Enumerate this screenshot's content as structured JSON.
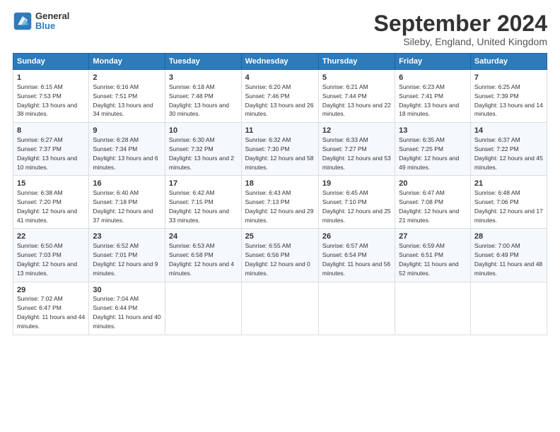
{
  "header": {
    "logo_line1": "General",
    "logo_line2": "Blue",
    "title": "September 2024",
    "subtitle": "Sileby, England, United Kingdom"
  },
  "weekdays": [
    "Sunday",
    "Monday",
    "Tuesday",
    "Wednesday",
    "Thursday",
    "Friday",
    "Saturday"
  ],
  "weeks": [
    [
      {
        "day": 1,
        "rise": "6:15 AM",
        "set": "7:53 PM",
        "daylight": "13 hours and 38 minutes."
      },
      {
        "day": 2,
        "rise": "6:16 AM",
        "set": "7:51 PM",
        "daylight": "13 hours and 34 minutes."
      },
      {
        "day": 3,
        "rise": "6:18 AM",
        "set": "7:48 PM",
        "daylight": "13 hours and 30 minutes."
      },
      {
        "day": 4,
        "rise": "6:20 AM",
        "set": "7:46 PM",
        "daylight": "13 hours and 26 minutes."
      },
      {
        "day": 5,
        "rise": "6:21 AM",
        "set": "7:44 PM",
        "daylight": "13 hours and 22 minutes."
      },
      {
        "day": 6,
        "rise": "6:23 AM",
        "set": "7:41 PM",
        "daylight": "13 hours and 18 minutes."
      },
      {
        "day": 7,
        "rise": "6:25 AM",
        "set": "7:39 PM",
        "daylight": "13 hours and 14 minutes."
      }
    ],
    [
      {
        "day": 8,
        "rise": "6:27 AM",
        "set": "7:37 PM",
        "daylight": "13 hours and 10 minutes."
      },
      {
        "day": 9,
        "rise": "6:28 AM",
        "set": "7:34 PM",
        "daylight": "13 hours and 6 minutes."
      },
      {
        "day": 10,
        "rise": "6:30 AM",
        "set": "7:32 PM",
        "daylight": "13 hours and 2 minutes."
      },
      {
        "day": 11,
        "rise": "6:32 AM",
        "set": "7:30 PM",
        "daylight": "12 hours and 58 minutes."
      },
      {
        "day": 12,
        "rise": "6:33 AM",
        "set": "7:27 PM",
        "daylight": "12 hours and 53 minutes."
      },
      {
        "day": 13,
        "rise": "6:35 AM",
        "set": "7:25 PM",
        "daylight": "12 hours and 49 minutes."
      },
      {
        "day": 14,
        "rise": "6:37 AM",
        "set": "7:22 PM",
        "daylight": "12 hours and 45 minutes."
      }
    ],
    [
      {
        "day": 15,
        "rise": "6:38 AM",
        "set": "7:20 PM",
        "daylight": "12 hours and 41 minutes."
      },
      {
        "day": 16,
        "rise": "6:40 AM",
        "set": "7:18 PM",
        "daylight": "12 hours and 37 minutes."
      },
      {
        "day": 17,
        "rise": "6:42 AM",
        "set": "7:15 PM",
        "daylight": "12 hours and 33 minutes."
      },
      {
        "day": 18,
        "rise": "6:43 AM",
        "set": "7:13 PM",
        "daylight": "12 hours and 29 minutes."
      },
      {
        "day": 19,
        "rise": "6:45 AM",
        "set": "7:10 PM",
        "daylight": "12 hours and 25 minutes."
      },
      {
        "day": 20,
        "rise": "6:47 AM",
        "set": "7:08 PM",
        "daylight": "12 hours and 21 minutes."
      },
      {
        "day": 21,
        "rise": "6:48 AM",
        "set": "7:06 PM",
        "daylight": "12 hours and 17 minutes."
      }
    ],
    [
      {
        "day": 22,
        "rise": "6:50 AM",
        "set": "7:03 PM",
        "daylight": "12 hours and 13 minutes."
      },
      {
        "day": 23,
        "rise": "6:52 AM",
        "set": "7:01 PM",
        "daylight": "12 hours and 9 minutes."
      },
      {
        "day": 24,
        "rise": "6:53 AM",
        "set": "6:58 PM",
        "daylight": "12 hours and 4 minutes."
      },
      {
        "day": 25,
        "rise": "6:55 AM",
        "set": "6:56 PM",
        "daylight": "12 hours and 0 minutes."
      },
      {
        "day": 26,
        "rise": "6:57 AM",
        "set": "6:54 PM",
        "daylight": "11 hours and 56 minutes."
      },
      {
        "day": 27,
        "rise": "6:59 AM",
        "set": "6:51 PM",
        "daylight": "11 hours and 52 minutes."
      },
      {
        "day": 28,
        "rise": "7:00 AM",
        "set": "6:49 PM",
        "daylight": "11 hours and 48 minutes."
      }
    ],
    [
      {
        "day": 29,
        "rise": "7:02 AM",
        "set": "6:47 PM",
        "daylight": "11 hours and 44 minutes."
      },
      {
        "day": 30,
        "rise": "7:04 AM",
        "set": "6:44 PM",
        "daylight": "11 hours and 40 minutes."
      },
      null,
      null,
      null,
      null,
      null
    ]
  ]
}
